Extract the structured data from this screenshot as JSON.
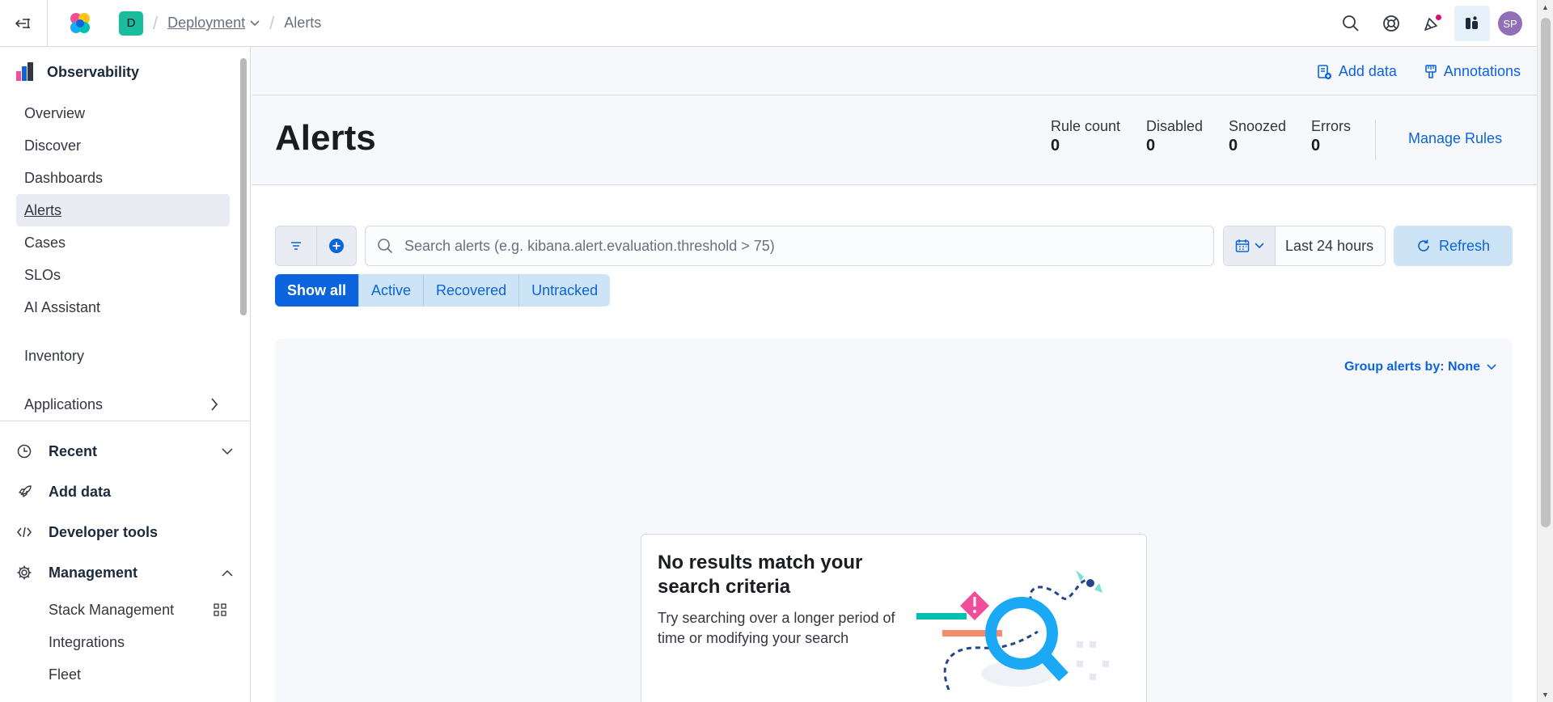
{
  "header": {
    "space_initial": "D",
    "breadcrumbs": [
      {
        "label": "Deployment"
      },
      {
        "label": "Alerts"
      }
    ],
    "user_initials": "SP"
  },
  "sidebar": {
    "solution_title": "Observability",
    "items": [
      {
        "label": "Overview"
      },
      {
        "label": "Discover"
      },
      {
        "label": "Dashboards"
      },
      {
        "label": "Alerts",
        "selected": true
      },
      {
        "label": "Cases"
      },
      {
        "label": "SLOs"
      },
      {
        "label": "AI Assistant"
      },
      {
        "label": "Inventory"
      },
      {
        "label": "Applications"
      }
    ],
    "sections": {
      "recent": "Recent",
      "add_data": "Add data",
      "developer_tools": "Developer tools",
      "management": "Management"
    },
    "management_items": [
      {
        "label": "Stack Management"
      },
      {
        "label": "Integrations"
      },
      {
        "label": "Fleet"
      }
    ]
  },
  "page": {
    "add_data_label": "Add data",
    "annotations_label": "Annotations",
    "title": "Alerts",
    "stats": [
      {
        "label": "Rule count",
        "value": "0"
      },
      {
        "label": "Disabled",
        "value": "0"
      },
      {
        "label": "Snoozed",
        "value": "0"
      },
      {
        "label": "Errors",
        "value": "0"
      }
    ],
    "manage_rules_label": "Manage Rules"
  },
  "query": {
    "search_placeholder": "Search alerts (e.g. kibana.alert.evaluation.threshold > 75)",
    "time_range": "Last 24 hours",
    "refresh_label": "Refresh"
  },
  "status_filter": {
    "options": [
      "Show all",
      "Active",
      "Recovered",
      "Untracked"
    ],
    "selected": "Show all"
  },
  "results": {
    "group_by_label": "Group alerts by: None",
    "empty_title": "No results match your search criteria",
    "empty_body": "Try searching over a longer period of time or modifying your search"
  },
  "colors": {
    "primary": "#0b64dd",
    "selected_bg": "#e9edf3",
    "space_avatar": "#1abc9c",
    "user_avatar": "#9170b8",
    "notification": "#dd0a73"
  }
}
